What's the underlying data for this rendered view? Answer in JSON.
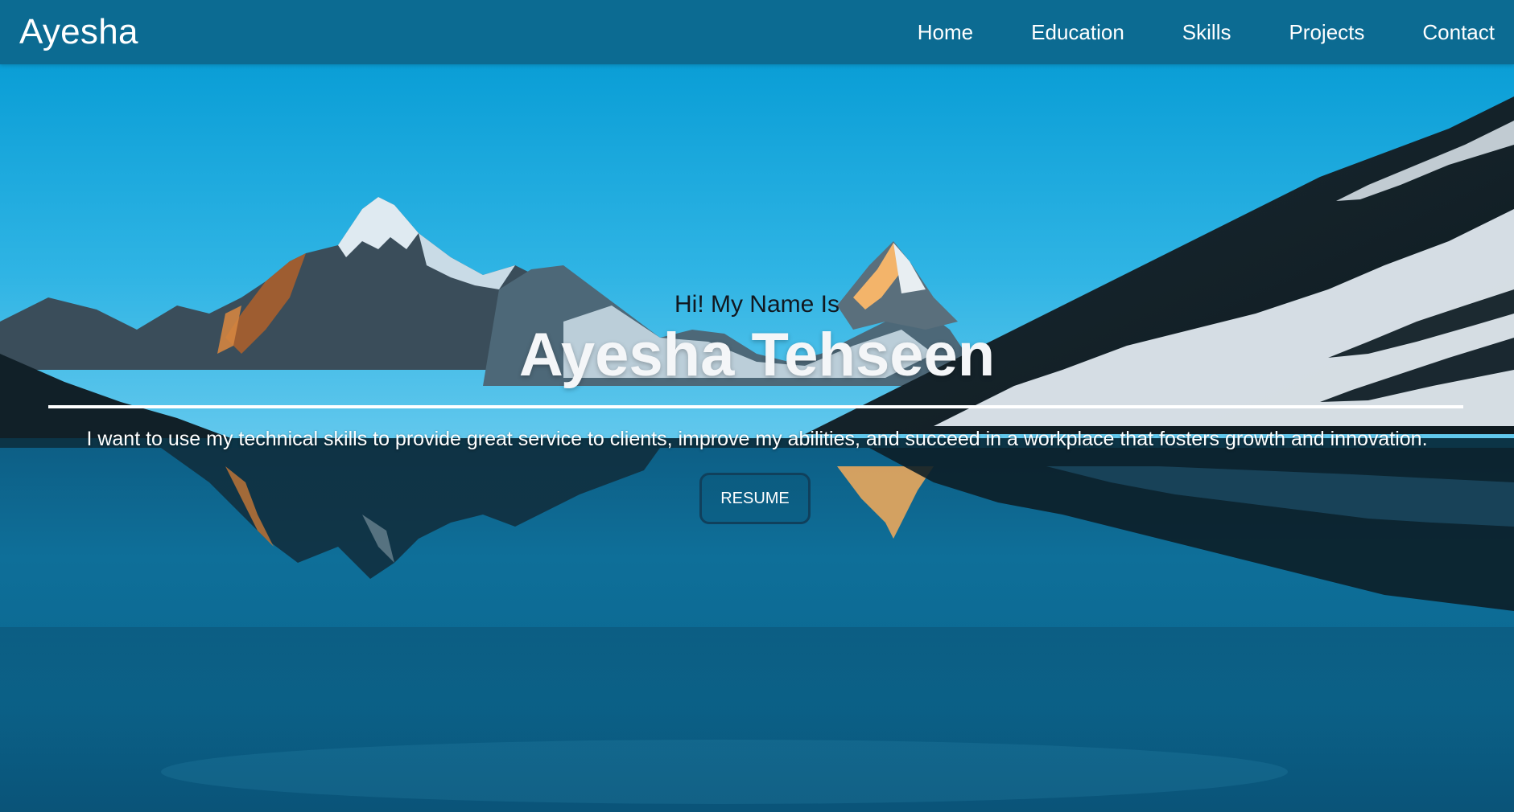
{
  "navbar": {
    "brand": "Ayesha",
    "links": [
      {
        "label": "Home"
      },
      {
        "label": "Education"
      },
      {
        "label": "Skills"
      },
      {
        "label": "Projects"
      },
      {
        "label": "Contact"
      }
    ]
  },
  "hero": {
    "greeting": "Hi! My Name Is",
    "name": "Ayesha Tehseen",
    "tagline": "I want to use my technical skills to provide great service to clients, improve my abilities, and succeed in a workplace that fosters growth and innovation.",
    "button_label": "RESUME",
    "background_image": "mountain-lake-landscape"
  },
  "colors": {
    "navbar": "#0c6b92",
    "sky": "#0aa0d6",
    "water": "#0a5f85",
    "text_light": "#ffffff"
  }
}
